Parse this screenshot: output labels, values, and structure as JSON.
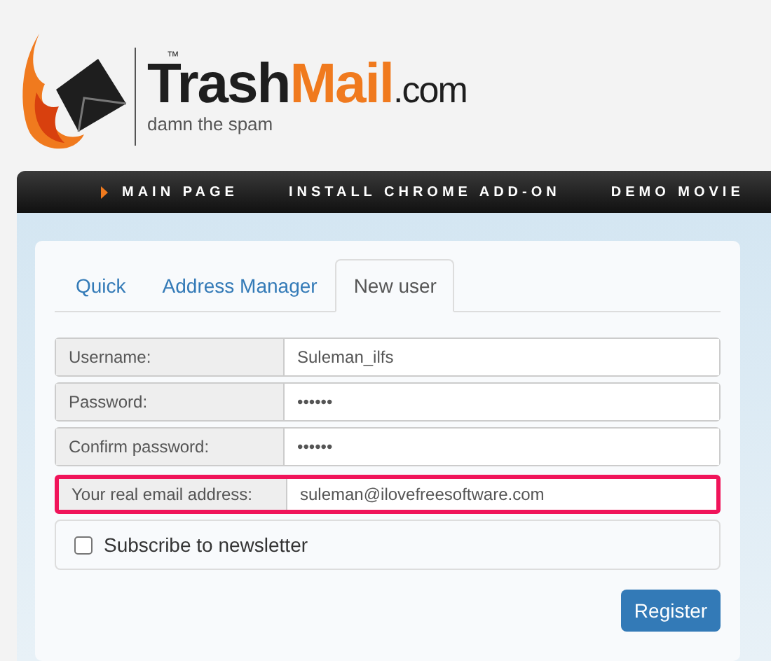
{
  "logo": {
    "wordmark": [
      {
        "text": "Trash",
        "accent": false,
        "small": false
      },
      {
        "text": "Mail",
        "accent": true,
        "small": false
      },
      {
        "text": ".com",
        "accent": false,
        "small": true
      }
    ],
    "trademark": "™",
    "tagline": "damn the spam"
  },
  "nav": [
    {
      "label": "MAIN PAGE",
      "selected": true
    },
    {
      "label": "INSTALL CHROME ADD-ON",
      "selected": false
    },
    {
      "label": "DEMO MOVIE",
      "selected": false
    }
  ],
  "tabs": [
    {
      "label": "Quick",
      "selected": false
    },
    {
      "label": "Address Manager",
      "selected": false
    },
    {
      "label": "New user",
      "selected": true
    }
  ],
  "form": {
    "fields": [
      {
        "label": "Username:",
        "value": "Suleman_ilfs",
        "highlighted": false
      },
      {
        "label": "Password:",
        "value": "••••••",
        "highlighted": false
      },
      {
        "label": "Confirm password:",
        "value": "••••••",
        "highlighted": false
      },
      {
        "label": "Your real email address:",
        "value": "suleman@ilovefreesoftware.com",
        "highlighted": true
      }
    ],
    "newsletter": {
      "label": "Subscribe to newsletter",
      "checked": false
    },
    "submit": "Register"
  }
}
